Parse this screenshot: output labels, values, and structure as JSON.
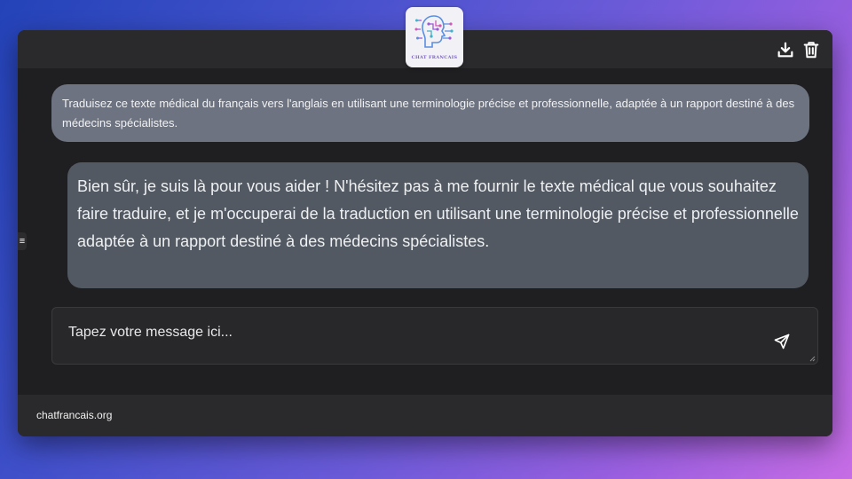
{
  "app": {
    "logo_text": "CHAT FRANCAIS"
  },
  "toolbar": {
    "download_icon": "download-icon",
    "delete_icon": "trash-icon"
  },
  "conversation": {
    "messages": [
      {
        "role": "user",
        "text": "Traduisez ce texte médical du français vers l'anglais en utilisant une terminologie précise et professionnelle, adaptée à un rapport destiné à des médecins spécialistes."
      },
      {
        "role": "assistant",
        "text": "Bien sûr, je suis là pour vous aider ! N'hésitez pas à me fournir le texte médical que vous souhaitez faire traduire, et je m'occuperai de la traduction en utilisant une terminologie précise et professionnelle adaptée à un rapport destiné à des médecins spécialistes."
      }
    ]
  },
  "sidebar_toggle": {
    "glyph": "≡"
  },
  "composer": {
    "placeholder": "Tapez votre message ici...",
    "value": "",
    "send_icon": "send-icon"
  },
  "footer": {
    "site": "chatfrancais.org"
  },
  "colors": {
    "window_bg": "#1f1f21",
    "bar_bg": "#2a2a2c",
    "user_bubble": "#6d7380",
    "assistant_bubble": "#525962",
    "logo_accent": "#7b5bd2"
  }
}
